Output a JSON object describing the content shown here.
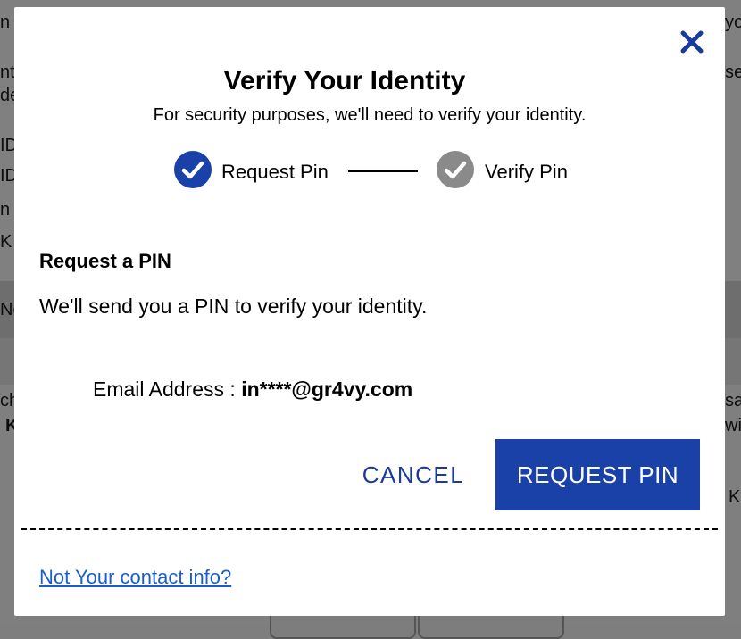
{
  "background": {
    "fragments": [
      "n",
      "yo",
      "nt",
      "se",
      "de",
      "ID",
      "ID",
      "n",
      "K",
      "No",
      "ch",
      "sa",
      "K",
      "wi",
      "K"
    ]
  },
  "modal": {
    "close_icon": "close-icon",
    "title": "Verify Your Identity",
    "subtitle": "For security purposes, we'll need to verify your identity.",
    "steps": [
      {
        "label": "Request Pin",
        "icon": "check-circle-icon",
        "color": "#1a41a8"
      },
      {
        "label": "Verify Pin",
        "icon": "check-circle-icon",
        "color": "#8a8a8a"
      }
    ],
    "section_title": "Request a PIN",
    "section_text": "We'll send you a PIN to verify your identity.",
    "email_label": "Email Address : ",
    "email_value": "in****@gr4vy.com",
    "cancel_label": "CANCEL",
    "request_label": "REQUEST PIN",
    "contact_link": "Not Your contact info?"
  },
  "colors": {
    "accent": "#1a41a8",
    "link": "#1a5fc8",
    "inactive": "#8a8a8a"
  }
}
